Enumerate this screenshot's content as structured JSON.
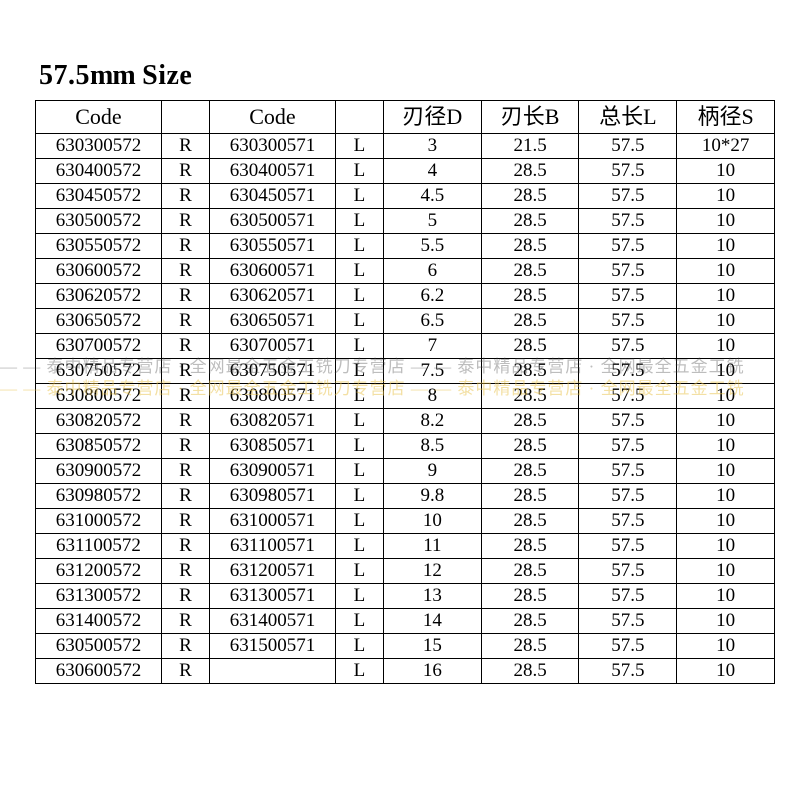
{
  "title_size": "57.5",
  "title_unit": "mm",
  "title_word": "Size",
  "headers": [
    "Code",
    "",
    "Code",
    "",
    "刃径D",
    "刃长B",
    "总长L",
    "柄径S"
  ],
  "rows": [
    [
      "630300572",
      "R",
      "630300571",
      "L",
      "3",
      "21.5",
      "57.5",
      "10*27"
    ],
    [
      "630400572",
      "R",
      "630400571",
      "L",
      "4",
      "28.5",
      "57.5",
      "10"
    ],
    [
      "630450572",
      "R",
      "630450571",
      "L",
      "4.5",
      "28.5",
      "57.5",
      "10"
    ],
    [
      "630500572",
      "R",
      "630500571",
      "L",
      "5",
      "28.5",
      "57.5",
      "10"
    ],
    [
      "630550572",
      "R",
      "630550571",
      "L",
      "5.5",
      "28.5",
      "57.5",
      "10"
    ],
    [
      "630600572",
      "R",
      "630600571",
      "L",
      "6",
      "28.5",
      "57.5",
      "10"
    ],
    [
      "630620572",
      "R",
      "630620571",
      "L",
      "6.2",
      "28.5",
      "57.5",
      "10"
    ],
    [
      "630650572",
      "R",
      "630650571",
      "L",
      "6.5",
      "28.5",
      "57.5",
      "10"
    ],
    [
      "630700572",
      "R",
      "630700571",
      "L",
      "7",
      "28.5",
      "57.5",
      "10"
    ],
    [
      "630750572",
      "R",
      "630750571",
      "L",
      "7.5",
      "28.5",
      "57.5",
      "10"
    ],
    [
      "630800572",
      "R",
      "630800571",
      "L",
      "8",
      "28.5",
      "57.5",
      "10"
    ],
    [
      "630820572",
      "R",
      "630820571",
      "L",
      "8.2",
      "28.5",
      "57.5",
      "10"
    ],
    [
      "630850572",
      "R",
      "630850571",
      "L",
      "8.5",
      "28.5",
      "57.5",
      "10"
    ],
    [
      "630900572",
      "R",
      "630900571",
      "L",
      "9",
      "28.5",
      "57.5",
      "10"
    ],
    [
      "630980572",
      "R",
      "630980571",
      "L",
      "9.8",
      "28.5",
      "57.5",
      "10"
    ],
    [
      "631000572",
      "R",
      "631000571",
      "L",
      "10",
      "28.5",
      "57.5",
      "10"
    ],
    [
      "631100572",
      "R",
      "631100571",
      "L",
      "11",
      "28.5",
      "57.5",
      "10"
    ],
    [
      "631200572",
      "R",
      "631200571",
      "L",
      "12",
      "28.5",
      "57.5",
      "10"
    ],
    [
      "631300572",
      "R",
      "631300571",
      "L",
      "13",
      "28.5",
      "57.5",
      "10"
    ],
    [
      "631400572",
      "R",
      "631400571",
      "L",
      "14",
      "28.5",
      "57.5",
      "10"
    ],
    [
      "630500572",
      "R",
      "631500571",
      "L",
      "15",
      "28.5",
      "57.5",
      "10"
    ],
    [
      "630600572",
      "R",
      "",
      "L",
      "16",
      "28.5",
      "57.5",
      "10"
    ]
  ],
  "watermark": "— — 泰中精品专营店 · 全网最全五金工铣刀专营店 — — 泰中精品专营店 · 全网最全五金工铣"
}
